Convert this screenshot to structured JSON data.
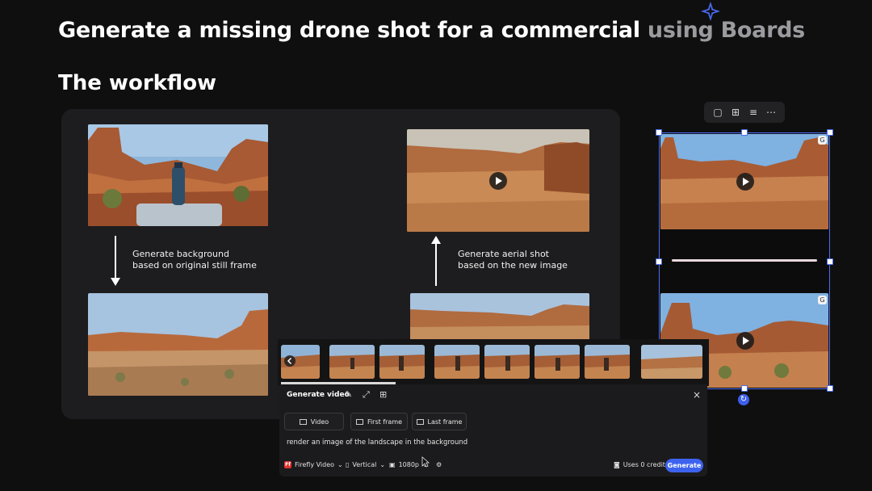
{
  "heading": {
    "main": "Generate a missing drone shot for a commercial",
    "muted": "using Boards"
  },
  "subheading": "The workflow",
  "workflow": {
    "step_left_line1": "Generate background",
    "step_left_line2": "based on original still frame",
    "step_right_line1": "Generate aerial shot",
    "step_right_line2": "based on the new image"
  },
  "toolbar": {
    "icons": [
      "frame-icon",
      "grid-icon",
      "align-icon",
      "more-icon"
    ]
  },
  "generate_panel": {
    "title": "Generate video",
    "modes": [
      "Video",
      "First frame",
      "Last frame"
    ],
    "prompt": "render an image of the landscape in the background",
    "model": "Firefly Video",
    "orientation": "Vertical",
    "resolution": "1080p",
    "credits": "Uses 0 credits",
    "generate_label": "Generate",
    "close_label": "×"
  },
  "badges": {
    "top_right": "G",
    "bottom_right": "G"
  },
  "colors": {
    "accent": "#3d63ee",
    "selection": "#4b6df0",
    "panel": "#1d1d1f",
    "background": "#0f0f10"
  }
}
